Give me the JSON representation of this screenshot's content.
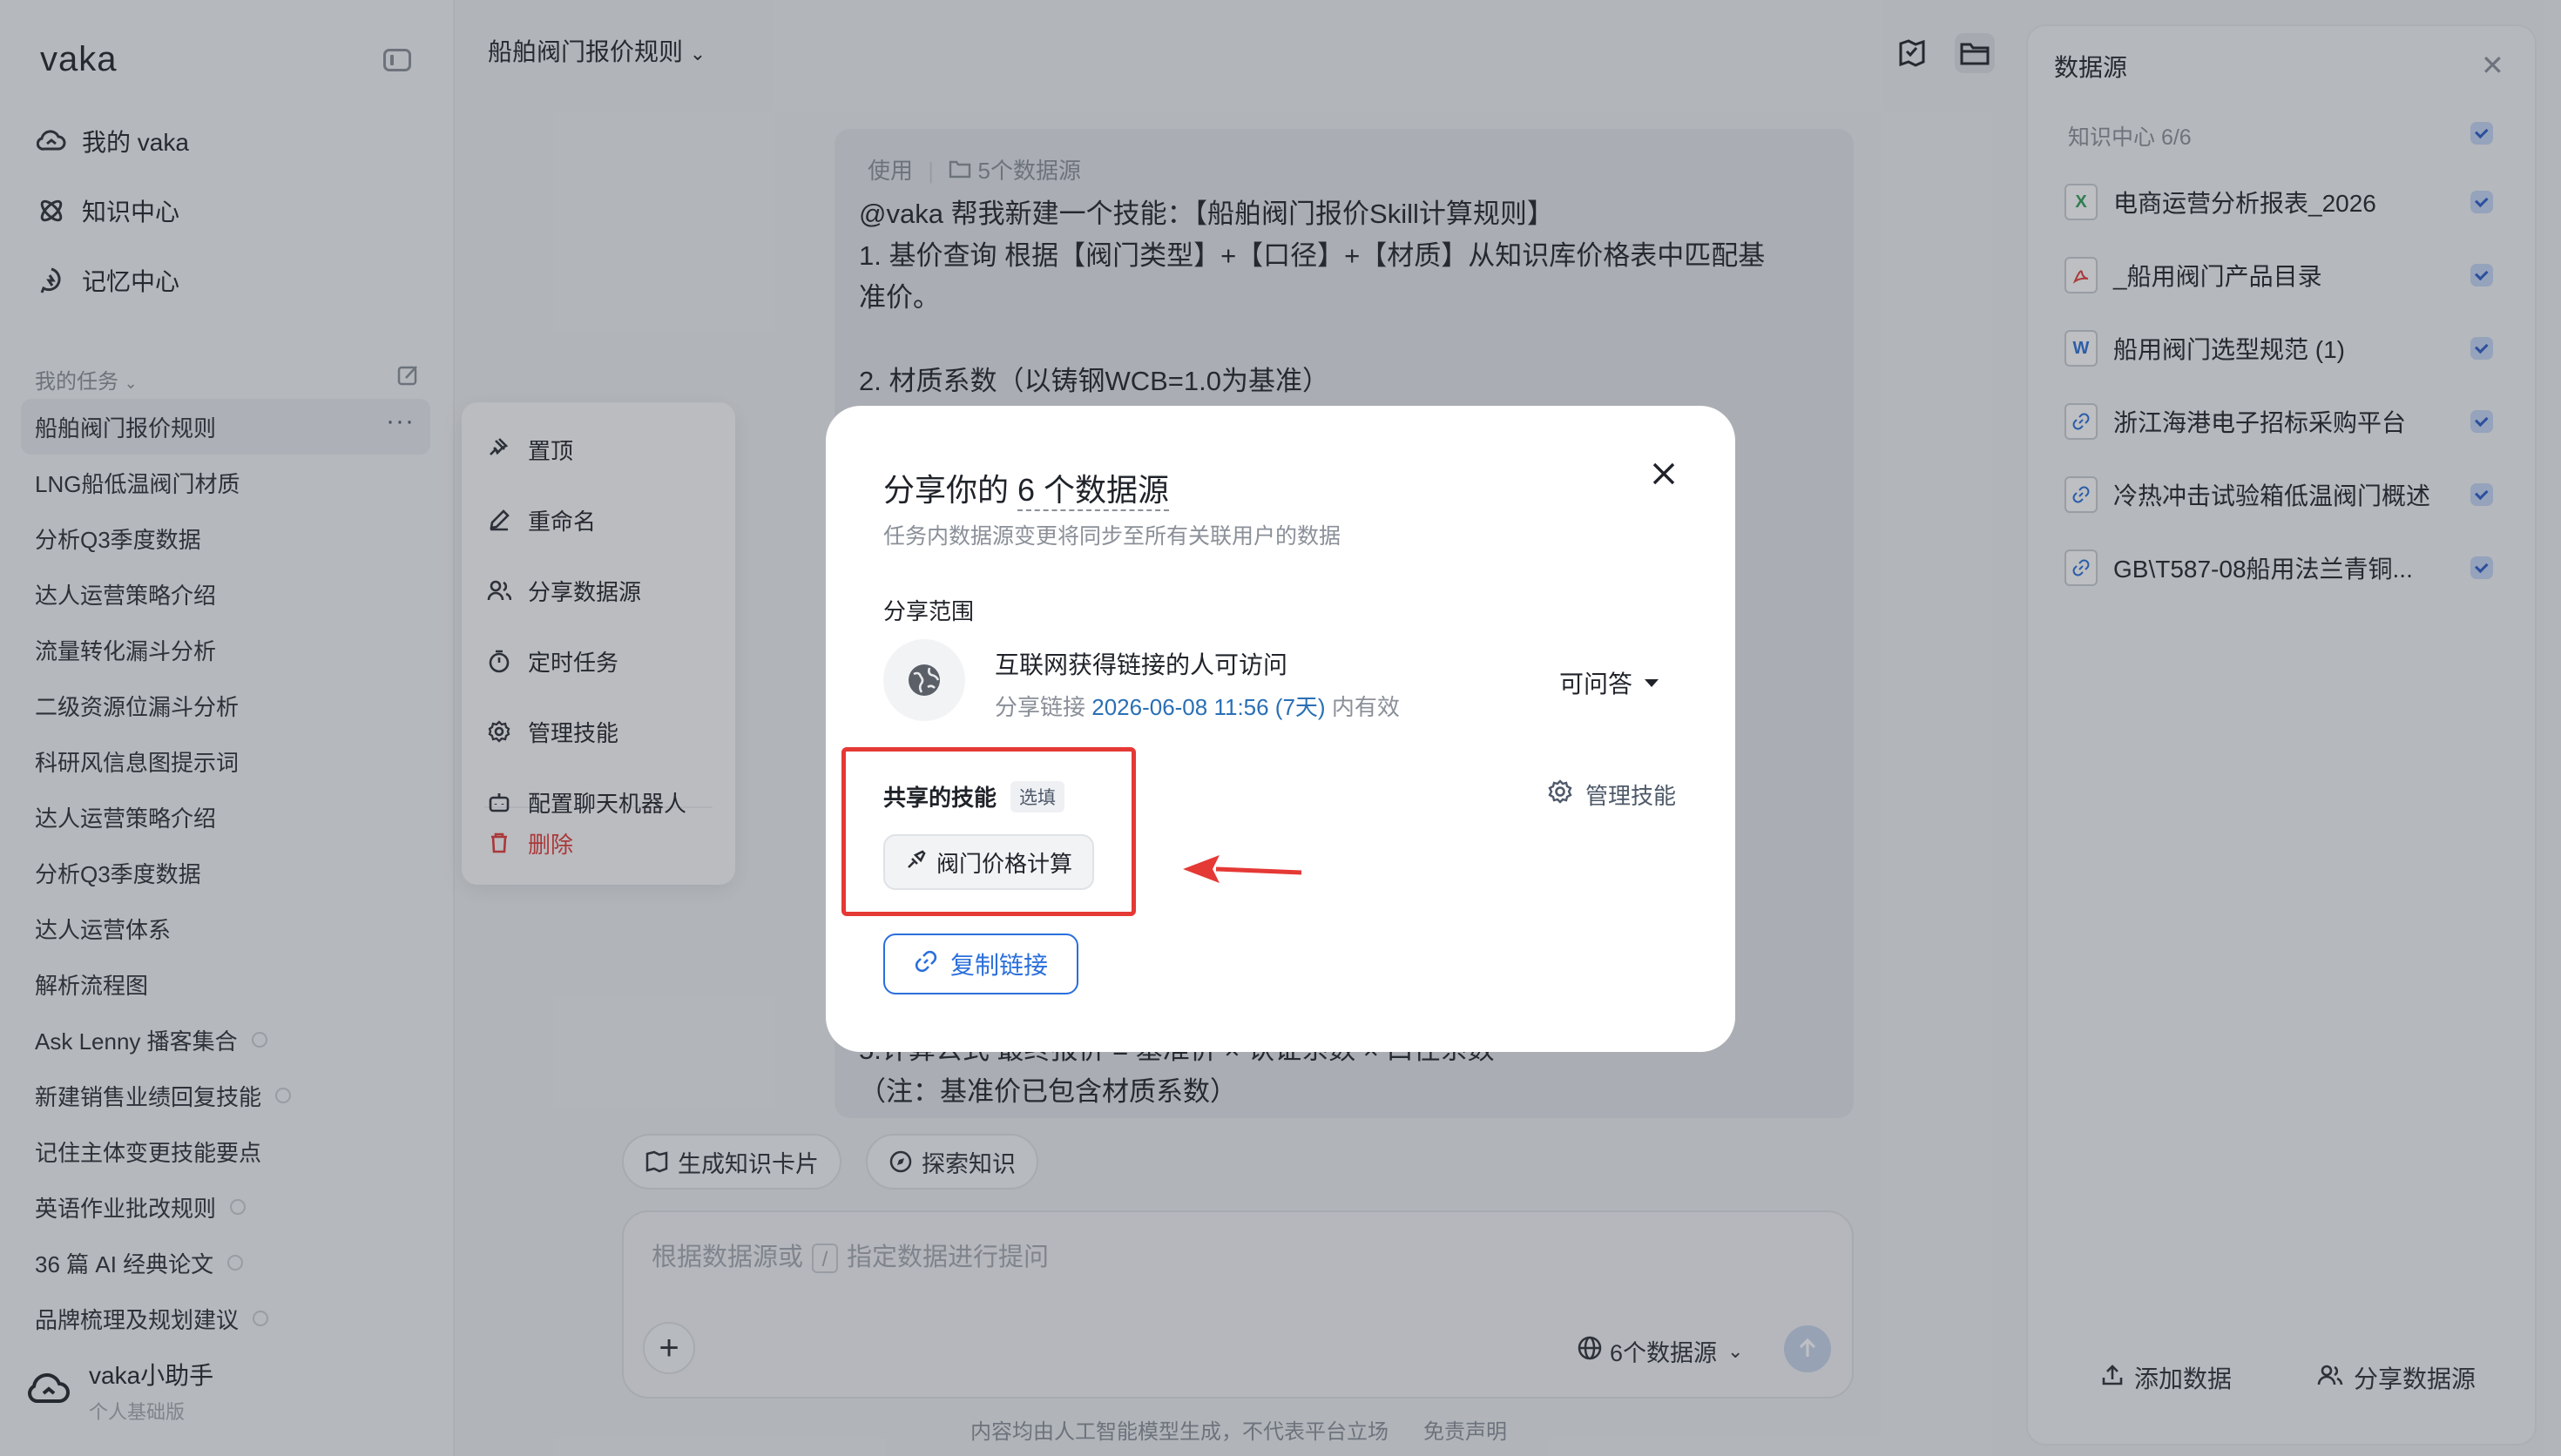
{
  "sidebar": {
    "logo": "vaka",
    "nav": [
      {
        "label": "我的 vaka",
        "icon": "cloud-icon"
      },
      {
        "label": "知识中心",
        "icon": "atom-icon"
      },
      {
        "label": "记忆中心",
        "icon": "memory-icon"
      }
    ],
    "section_label": "我的任务",
    "tasks": [
      {
        "label": "船舶阀门报价规则",
        "active": true
      },
      {
        "label": "LNG船低温阀门材质"
      },
      {
        "label": "分析Q3季度数据"
      },
      {
        "label": "达人运营策略介绍"
      },
      {
        "label": "流量转化漏斗分析"
      },
      {
        "label": "二级资源位漏斗分析"
      },
      {
        "label": "科研风信息图提示词"
      },
      {
        "label": "达人运营策略介绍"
      },
      {
        "label": "分析Q3季度数据"
      },
      {
        "label": "达人运营体系"
      },
      {
        "label": "解析流程图"
      },
      {
        "label": "Ask Lenny 播客集合",
        "shared": true
      },
      {
        "label": "新建销售业绩回复技能",
        "shared": true
      },
      {
        "label": "记住主体变更技能要点"
      },
      {
        "label": "英语作业批改规则",
        "shared": true
      },
      {
        "label": "36 篇 AI 经典论文",
        "shared": true
      },
      {
        "label": "品牌梳理及规划建议",
        "shared": true
      }
    ],
    "more_label": "···",
    "assistant": {
      "name": "vaka小助手",
      "plan": "个人基础版"
    }
  },
  "context_menu": {
    "items": [
      {
        "label": "置顶",
        "icon": "pin-icon"
      },
      {
        "label": "重命名",
        "icon": "pencil-icon"
      },
      {
        "label": "分享数据源",
        "icon": "users-icon"
      },
      {
        "label": "定时任务",
        "icon": "timer-icon"
      },
      {
        "label": "管理技能",
        "icon": "gear-icon"
      },
      {
        "label": "配置聊天机器人",
        "icon": "bot-icon"
      }
    ],
    "delete_label": "删除",
    "delete_color": "#e53935"
  },
  "main": {
    "title": "船舶阀门报价规则",
    "message": {
      "meta_use": "使用",
      "meta_sources": "5个数据源",
      "lines": [
        "@vaka  帮我新建一个技能：【船舶阀门报价Skill计算规则】",
        "1. 基价查询   根据【阀门类型】+【口径】+【材质】从知识库价格表中匹配基",
        "准价。",
        "",
        "2. 材质系数（以铸钢WCB=1.0为基准）"
      ],
      "tail_lines": [
        "5.计算公式   最终报价 = 基准价 × 认证系数 × 口径系数",
        " （注：基准价已包含材质系数）"
      ]
    },
    "chips": [
      {
        "label": "生成知识卡片",
        "icon": "cards-icon"
      },
      {
        "label": "探索知识",
        "icon": "compass-icon"
      }
    ],
    "input": {
      "placeholder_pre": "根据数据源或",
      "slash": "/",
      "placeholder_post": "指定数据进行提问"
    },
    "ds_select": "6个数据源",
    "footer": "内容均由人工智能模型生成，不代表平台立场",
    "disclaimer": "免责声明"
  },
  "right_panel": {
    "title": "数据源",
    "group": "知识中心 6/6",
    "files": [
      {
        "name": "电商运营分析报表_2026",
        "type": "X",
        "color": "#2e9e5b"
      },
      {
        "name": "_船用阀门产品目录",
        "type": "PDF",
        "color": "#e53935"
      },
      {
        "name": "船用阀门选型规范 (1)",
        "type": "W",
        "color": "#2a6fdb"
      },
      {
        "name": "浙江海港电子招标采购平台",
        "type": "link",
        "color": "#2a6fdb"
      },
      {
        "name": "冷热冲击试验箱低温阀门概述",
        "type": "link",
        "color": "#2a6fdb"
      },
      {
        "name": "GB\\T587-08船用法兰青铜...",
        "type": "link",
        "color": "#2a6fdb"
      }
    ],
    "add_label": "添加数据",
    "share_label": "分享数据源"
  },
  "modal": {
    "title_pre": "分享你的 ",
    "title_count": "6 个数据源",
    "subtitle": "任务内数据源变更将同步至所有关联用户的数据",
    "scope_label": "分享范围",
    "access": "互联网获得链接的人可访问",
    "expire_pre": "分享链接 ",
    "expire_date": "2026-06-08 11:56 (7天)",
    "expire_post": " 内有效",
    "permission": "可问答",
    "skills_label": "共享的技能",
    "optional_tag": "选填",
    "manage_label": "管理技能",
    "skill": "阀门价格计算",
    "copy_label": "复制链接",
    "accent": "#2a6fdb",
    "highlight": "#e53935"
  }
}
